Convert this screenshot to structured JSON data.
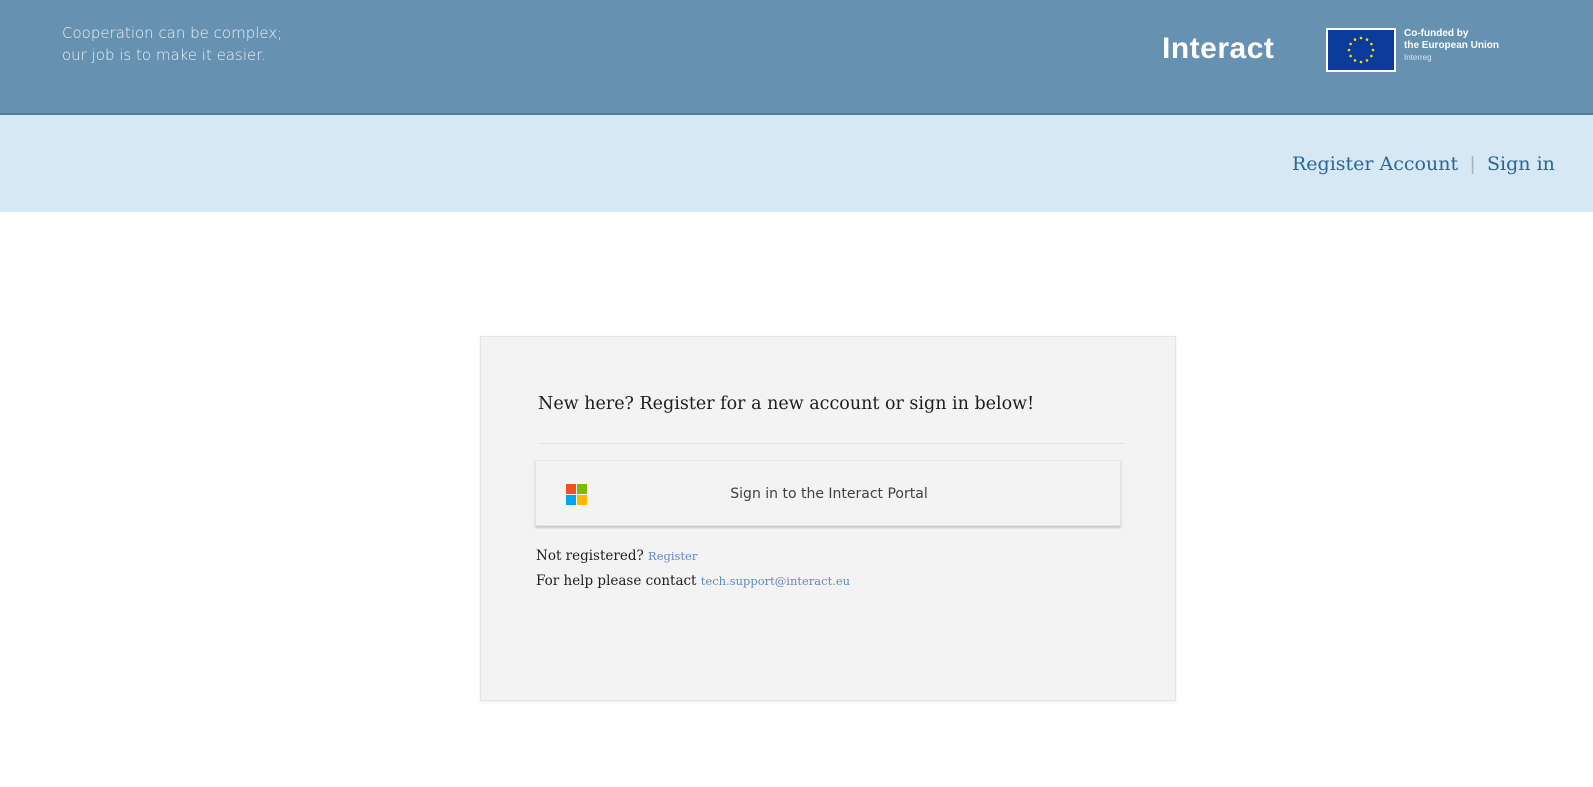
{
  "header": {
    "tagline_line1": "Cooperation can be complex;",
    "tagline_line2": "our job is to make it easier.",
    "brand": "Interact",
    "eu_line1": "Co-funded by",
    "eu_line2": "the European Union",
    "eu_line3": "Interreg"
  },
  "nav": {
    "register_account": "Register Account",
    "separator": "|",
    "sign_in": "Sign in"
  },
  "card": {
    "title": "New here? Register for a new account or sign in below!",
    "ms_button_label": "Sign in to the Interact Portal",
    "not_registered_text": "Not registered?",
    "register_link": "Register",
    "help_text": "For help please contact",
    "support_email": "tech.support@interact.eu"
  },
  "colors": {
    "header_bg": "#6691b1",
    "subnav_bg": "#d5e8f4",
    "link": "#2d6595",
    "card_bg": "#f3f3f3",
    "eu_blue": "#0b3c9c"
  },
  "icons": {
    "ms_logo": "microsoft-logo-icon",
    "eu_flag": "eu-flag-icon"
  }
}
